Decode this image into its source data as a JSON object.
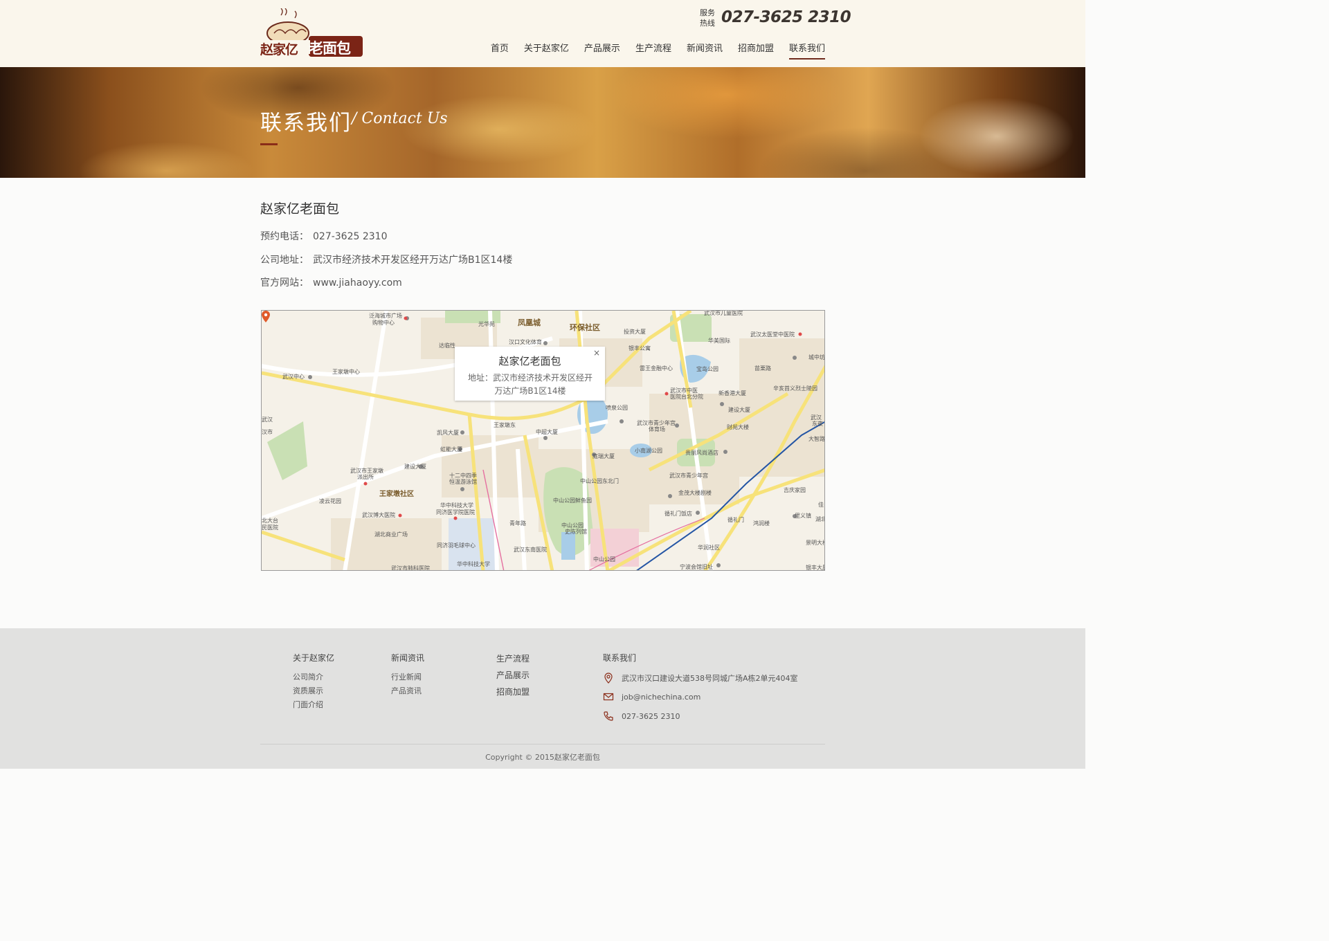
{
  "header": {
    "logo_text": "赵家亿老面包",
    "hotline_label_1": "服务",
    "hotline_label_2": "热线",
    "hotline_number": "027-3625  2310",
    "nav": [
      "首页",
      "关于赵家亿",
      "产品展示",
      "生产流程",
      "新闻资讯",
      "招商加盟",
      "联系我们"
    ],
    "active_nav": "联系我们"
  },
  "banner": {
    "title": "联系我们",
    "subtitle": "/ Contact Us"
  },
  "contact": {
    "company": "赵家亿老面包",
    "phone_label": "预约电话：",
    "phone": "027-3625 2310",
    "address_label": "公司地址：",
    "address": "武汉市经济技术开发区经开万达广场B1区14楼",
    "website_label": "官方网站：",
    "website": "www.jiahaoyy.com"
  },
  "map": {
    "popup_title": "赵家亿老面包",
    "popup_address": "地址：武汉市经济技术开发区经开万达广场B1区14楼",
    "close_symbol": "×",
    "labels": [
      "凤凰城",
      "环保社区",
      "王家墩社区",
      "武汉中心",
      "王家墩中心",
      "泛海城市广场购物中心",
      "汉口文化体育",
      "达临性",
      "光华苑",
      "凯风大厦",
      "虹能大厦",
      "建设大厦",
      "十二中四季恒温游泳馆",
      "武汉市王家墩派出所",
      "凌云花园",
      "武汉博大医院",
      "湖北商业广场",
      "华中科技大学同济医学院医院",
      "同济羽毛球中心",
      "华中科技大学同济医学院",
      "武汉市肺科医院",
      "王家墩东",
      "中超大厦",
      "庭瑞大厦",
      "中山公园东北门",
      "中山公园鲜鱼园",
      "中山公园史陈列馆",
      "青年路",
      "武汉东南医院",
      "中山公园",
      "喷泉公园",
      "小南湖公园",
      "宝岛公园",
      "武汉市青少年宫体育场",
      "贵丽风尚酒店",
      "武汉市青少年宫",
      "金茂大楼剧楼",
      "循礼门饭店",
      "循礼门",
      "武汉市儿童医院",
      "武汉太医堂中医院",
      "华美国际",
      "城中坊",
      "苗栗路",
      "新香港大厦",
      "辛亥首义烈士陵园",
      "建设大厦",
      "财苑大楼",
      "武汉市中医医院台北分院",
      "雷王金融中心",
      "银丰公寓",
      "投资大厦",
      "大智路",
      "吉庆家园",
      "鸿润楼",
      "里义镇",
      "景明大楼",
      "银丰大厦",
      "宁波会馆旧址",
      "华商社区",
      "解放大道",
      "新华路",
      "武汉大厦",
      "环保"
    ]
  },
  "footer": {
    "col1": {
      "head": "关于赵家亿",
      "links": [
        "公司简介",
        "资质展示",
        "门面介绍"
      ]
    },
    "col2": {
      "head": "新闻资讯",
      "links": [
        "行业新闻",
        "产品资讯"
      ]
    },
    "col3": {
      "links": [
        "生产流程",
        "产品展示",
        "招商加盟"
      ]
    },
    "col4": {
      "head": "联系我们",
      "address": "武汉市汉口建设大道538号同城广场A栋2单元404室",
      "email": "job@nichechina.com",
      "phone": "027-3625 2310"
    },
    "copyright": "Copyright  ©  2015赵家亿老面包"
  }
}
